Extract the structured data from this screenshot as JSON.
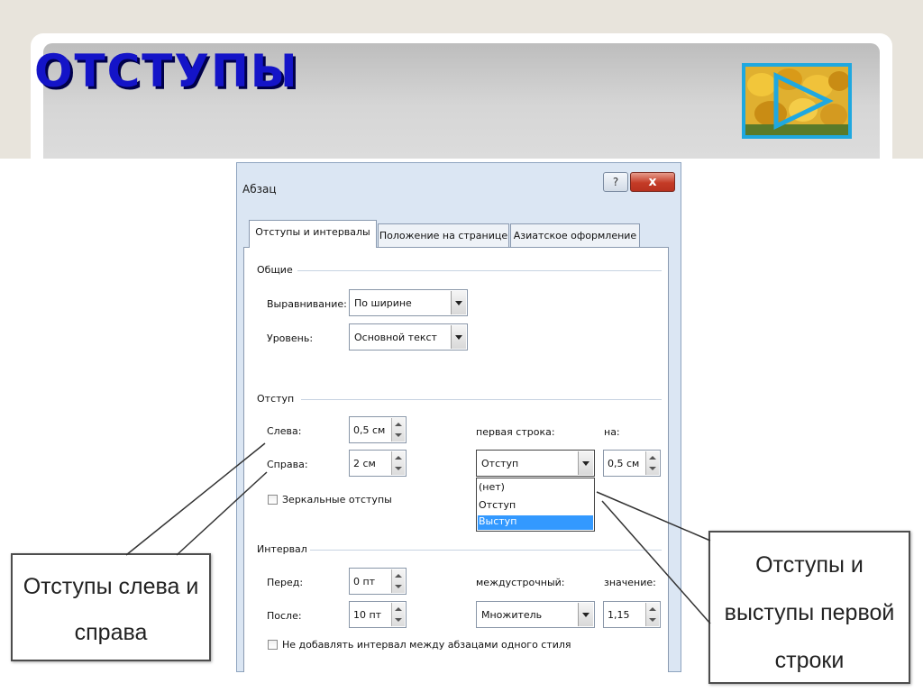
{
  "slide": {
    "title": "ОТСТУПЫ"
  },
  "play_button": {
    "icon": "play-triangle-icon"
  },
  "dialog": {
    "title": "Абзац",
    "help_label": "?",
    "close_label": "x",
    "tabs": [
      "Отступы и интервалы",
      "Положение на странице",
      "Азиатское оформление"
    ],
    "general": {
      "heading": "Общие",
      "alignment_label": "Выравнивание:",
      "alignment_value": "По ширине",
      "level_label": "Уровень:",
      "level_value": "Основной текст"
    },
    "indent": {
      "heading": "Отступ",
      "left_label": "Слева:",
      "left_value": "0,5 см",
      "right_label": "Справа:",
      "right_value": "2 см",
      "first_line_label": "первая строка:",
      "first_line_value": "Отступ",
      "by_label": "на:",
      "by_value": "0,5 см",
      "mirror_label": "Зеркальные отступы",
      "first_line_options": [
        "(нет)",
        "Отступ",
        "Выступ"
      ],
      "first_line_highlighted": "Выступ"
    },
    "spacing": {
      "heading": "Интервал",
      "before_label": "Перед:",
      "before_value": "0 пт",
      "after_label": "После:",
      "after_value": "10 пт",
      "line_spacing_label": "междустрочный:",
      "line_spacing_value": "Множитель",
      "value_label": "значение:",
      "value_value": "1,15",
      "no_space_label": "Не добавлять интервал между абзацами одного стиля"
    }
  },
  "callouts": {
    "left": [
      "Отступы слева и",
      "справа"
    ],
    "right": [
      "Отступы и",
      "выступы первой",
      "строки"
    ]
  },
  "colors": {
    "title": "#1414c8",
    "title_shadow": "#00004a",
    "play_border": "#1fa8e0",
    "selection": "#3399ff",
    "close_button": "#c43b26"
  }
}
